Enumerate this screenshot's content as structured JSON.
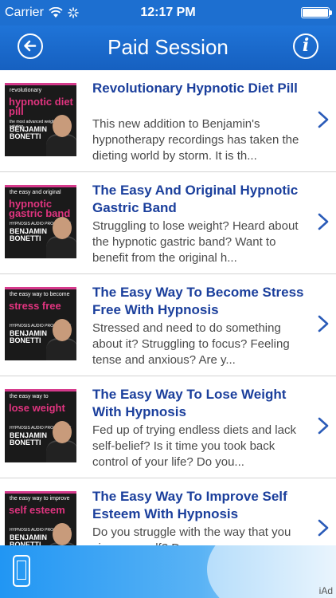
{
  "status": {
    "carrier": "Carrier",
    "time": "12:17 PM",
    "battery_level": 1.0
  },
  "navbar": {
    "title": "Paid Session",
    "back_icon": "back-arrow-icon",
    "info_label": "i"
  },
  "items": [
    {
      "title": "Revolutionary Hypnotic Diet Pill",
      "description": "This new addition to Benjamin's hypnotherapy recordings has taken the dieting world by storm. It is th...",
      "cover": {
        "small": "revolutionary",
        "big": "hypnotic diet pill",
        "prog": "the most advanced weight-loss solution...",
        "brand1": "BENJAMIN",
        "brand2": "BONETTI"
      }
    },
    {
      "title": "The Easy And Original Hypnotic Gastric Band",
      "description": "Struggling to lose weight? Heard about the hypnotic gastric band? Want to benefit from the original h...",
      "cover": {
        "small": "the easy and original",
        "big": "hypnotic gastric band",
        "prog": "HYPNOSIS AUDIO PROGRAMME",
        "brand1": "BENJAMIN",
        "brand2": "BONETTI"
      }
    },
    {
      "title": "The Easy Way To Become Stress Free With Hypnosis",
      "description": "Stressed and need to do something about it? Struggling to focus? Feeling tense and anxious?  Are y...",
      "cover": {
        "small": "the easy way to become",
        "big": "stress free",
        "prog": "HYPNOSIS AUDIO PROGRAMME",
        "brand1": "BENJAMIN",
        "brand2": "BONETTI"
      }
    },
    {
      "title": "The Easy Way To Lose Weight With Hypnosis",
      "description": "Fed up of trying endless diets and lack self-belief? Is it time you took back control of your life? Do you...",
      "cover": {
        "small": "the easy way to",
        "big": "lose weight",
        "prog": "HYPNOSIS AUDIO PROGRAMME",
        "brand1": "BENJAMIN",
        "brand2": "BONETTI"
      }
    },
    {
      "title": "The Easy Way To Improve Self Esteem With Hypnosis",
      "description": "Do you struggle with the way that you view yourself? Do you...",
      "cover": {
        "small": "the easy way to improve",
        "big": "self esteem",
        "prog": "HYPNOSIS AUDIO PROGRAMME",
        "brand1": "BENJAMIN",
        "brand2": "BONETTI"
      }
    }
  ],
  "ad": {
    "label": "iAd"
  },
  "colors": {
    "accent": "#1d6fd0",
    "title": "#1b3f9c",
    "pink": "#e0347f"
  }
}
